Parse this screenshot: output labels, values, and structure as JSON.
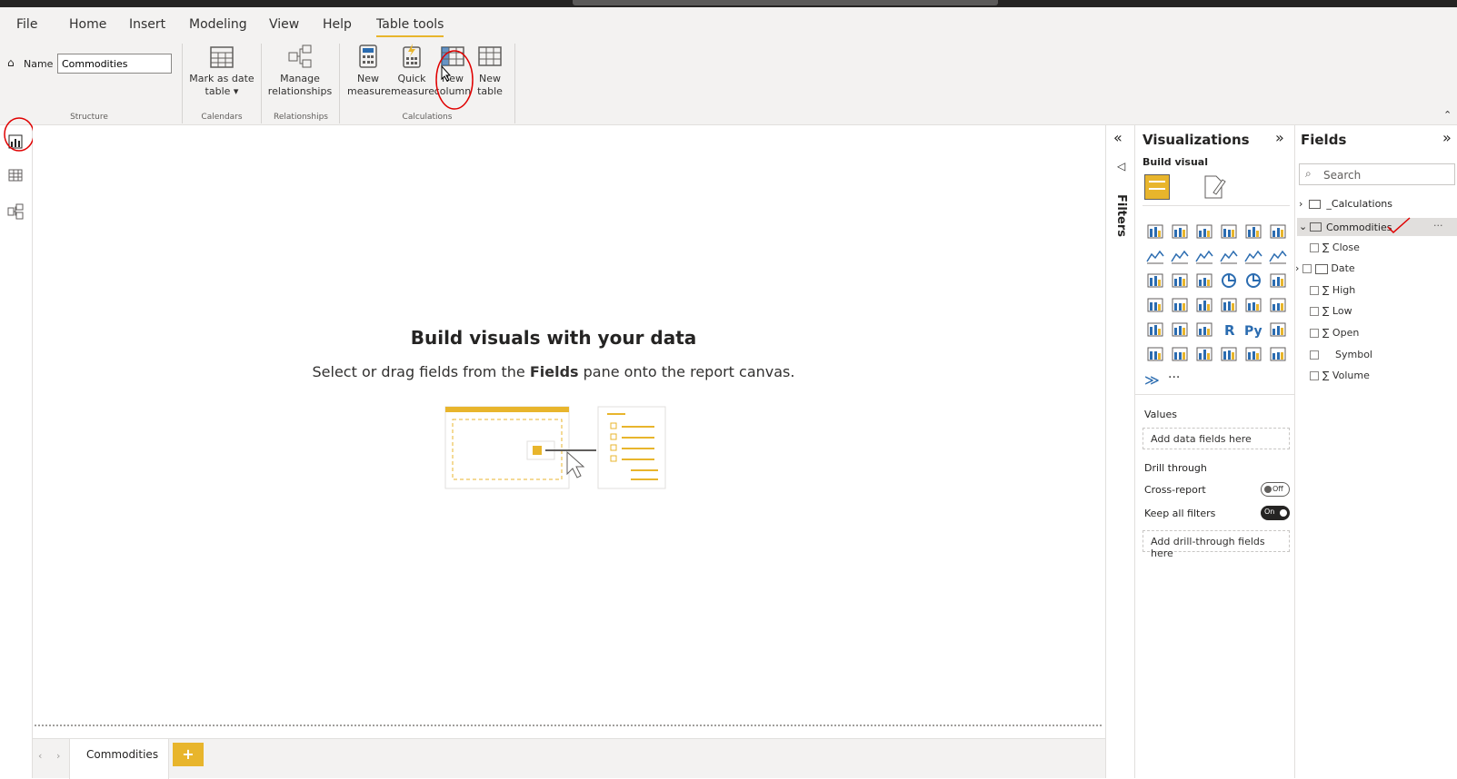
{
  "menu": {
    "items": [
      {
        "label": "File"
      },
      {
        "label": "Home"
      },
      {
        "label": "Insert"
      },
      {
        "label": "Modeling"
      },
      {
        "label": "View"
      },
      {
        "label": "Help"
      },
      {
        "label": "Table tools"
      }
    ]
  },
  "ribbon": {
    "name_label": "Name",
    "name_value": "Commodities",
    "groups": {
      "structure": "Structure",
      "calendars": "Calendars",
      "relationships": "Relationships",
      "calculations": "Calculations"
    },
    "buttons": {
      "mark_date_1": "Mark as date",
      "mark_date_2": "table ▾",
      "manage_rel_1": "Manage",
      "manage_rel_2": "relationships",
      "new_measure_1": "New",
      "new_measure_2": "measure",
      "quick_measure_1": "Quick",
      "quick_measure_2": "measure",
      "new_column_1": "New",
      "new_column_2": "column",
      "new_table_1": "New",
      "new_table_2": "table"
    }
  },
  "canvas": {
    "heading": "Build visuals with your data",
    "sub_before": "Select or drag fields from the ",
    "sub_bold": "Fields",
    "sub_after": " pane onto the report canvas."
  },
  "tabs": {
    "page_name": "Commodities",
    "add_label": "+"
  },
  "filters": {
    "label": "Filters"
  },
  "visualizations": {
    "title": "Visualizations",
    "build_visual": "Build visual",
    "values_label": "Values",
    "values_placeholder": "Add data fields here",
    "drill_through": "Drill through",
    "cross_report": "Cross-report",
    "cross_report_state": "Off",
    "keep_filters": "Keep all filters",
    "keep_filters_state": "On",
    "drill_placeholder": "Add drill-through fields here",
    "more": "···"
  },
  "fields_pane": {
    "title": "Fields",
    "search_placeholder": "Search",
    "tables": [
      {
        "name": "_Calculations"
      },
      {
        "name": "Commodities"
      }
    ],
    "columns": [
      {
        "name": "Close",
        "sigma": "∑"
      },
      {
        "name": "Date",
        "sigma": ""
      },
      {
        "name": "High",
        "sigma": "∑"
      },
      {
        "name": "Low",
        "sigma": "∑"
      },
      {
        "name": "Open",
        "sigma": "∑"
      },
      {
        "name": "Symbol",
        "sigma": ""
      },
      {
        "name": "Volume",
        "sigma": "∑"
      }
    ]
  },
  "colors": {
    "accent": "#e8b52c",
    "annotation": "#e00000",
    "ribbon_bg": "#f3f2f1"
  }
}
